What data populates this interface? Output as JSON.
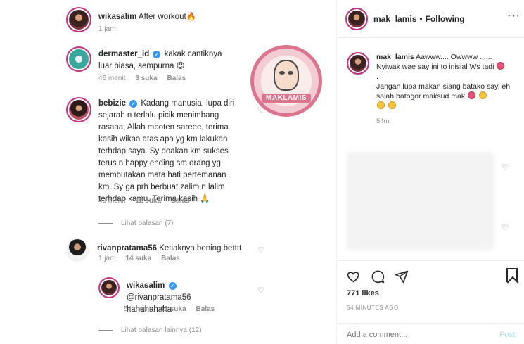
{
  "left": {
    "comments": [
      {
        "username": "wikasalim",
        "verified": false,
        "text": "After workout🔥",
        "time": "1 jam",
        "likes": "",
        "reply": ""
      },
      {
        "username": "dermaster_id",
        "verified": true,
        "text": "kakak cantiknya luar biasa, sempurna 😍",
        "time": "46 menit",
        "likes": "3 suka",
        "reply": "Balas"
      },
      {
        "username": "bebizie",
        "verified": true,
        "text": "Kadang manusia, lupa diri sejarah n terlalu picik menimbang rasaaa, Allah mboten sareee, terima kasih wikaa atas apa yg km lakukan terhdap saya. Sy doakan km sukses terus n happy ending sm orang yg membutakan mata hati pertemanan km. Sy ga prh berbuat zalim n lalim terhdap kamu. Terima kasih 🙏",
        "time": "43 menit",
        "likes": "12 suka",
        "reply": "Balas"
      },
      {
        "username": "rivanpratama56",
        "verified": false,
        "text": "Ketiaknya bening betttt",
        "time": "1 jam",
        "likes": "14 suka",
        "reply": "Balas"
      },
      {
        "username": "wikasalim",
        "verified": true,
        "text": "@rivanpratama56 hahahahaha",
        "time": "54 menit",
        "likes": "11 suka",
        "reply": "Balas"
      }
    ],
    "view_replies_1": "Lihat balasan (7)",
    "view_replies_2": "Lihat balasan lainnya (12)",
    "watermark": "MAKLAMIS"
  },
  "right": {
    "header": {
      "username": "mak_lamis",
      "dot": "•",
      "following": "Following"
    },
    "caption": {
      "username": "mak_lamis",
      "line1": "Aawww.... Owwww ......",
      "line2": "Nyiwak wae say ini to inisial Ws tadi",
      "line3": ".",
      "line4": "Jangan lupa makan siang batako say, eh salah batogor maksud mak",
      "time": "54m"
    },
    "likes": "771 likes",
    "post_time": "54 MINUTES AGO",
    "comment_placeholder": "Add a comment...",
    "post_label": "Post"
  },
  "icons": {
    "heart": "heart-icon",
    "comment": "comment-icon",
    "share": "share-icon",
    "bookmark": "bookmark-icon",
    "more": "more-icon",
    "verified": "verified-badge-icon"
  },
  "colors": {
    "accent": "#3897f0",
    "muted": "#8e8e8e",
    "post": "#b2dffc",
    "story_ring": "#c13584"
  }
}
